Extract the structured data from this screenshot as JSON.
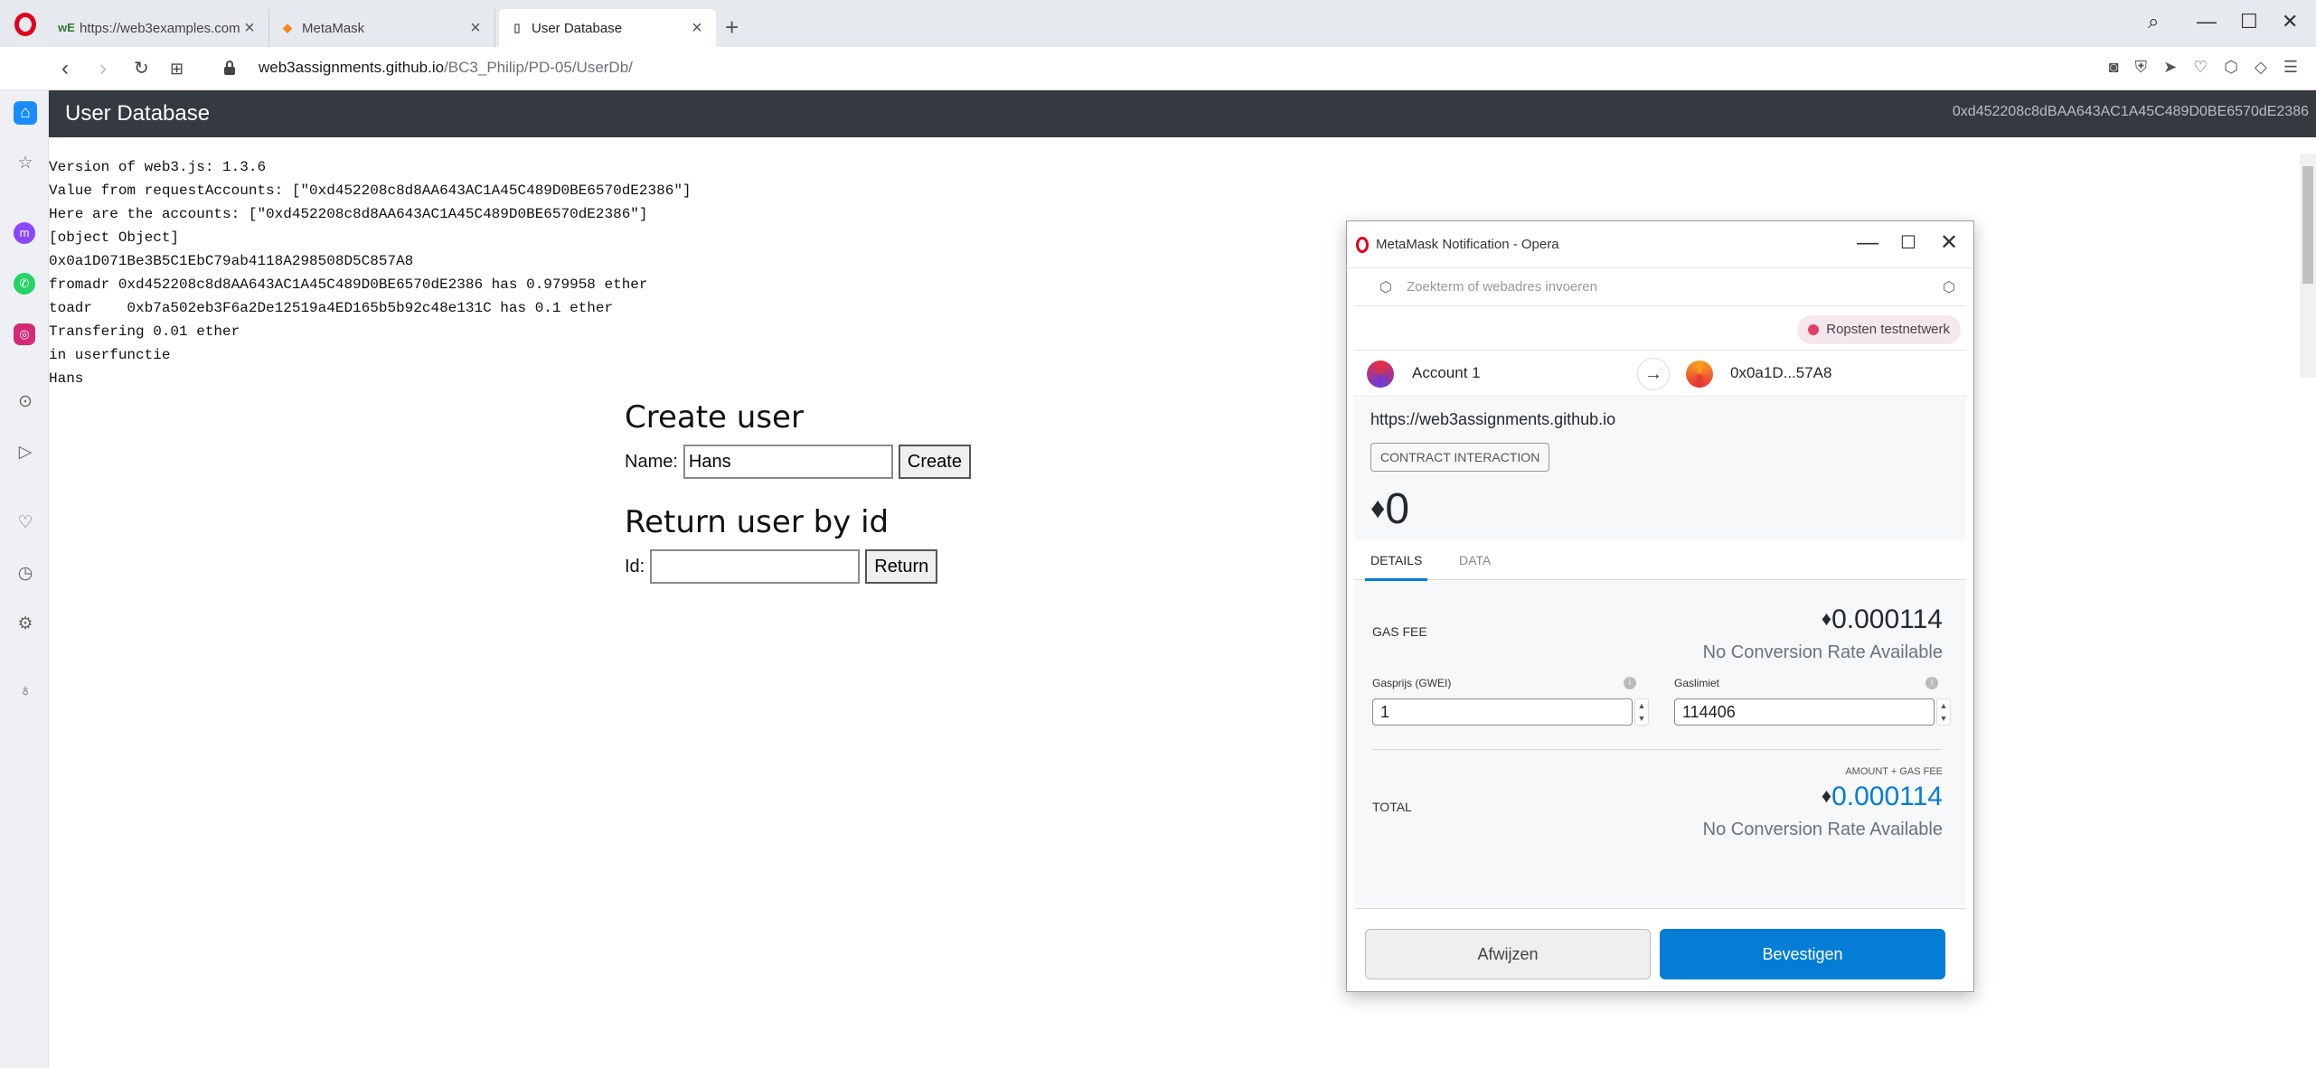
{
  "browser": {
    "tabs": [
      {
        "label": "https://web3examples.com",
        "favicon": "wE"
      },
      {
        "label": "MetaMask",
        "favicon": "fox"
      },
      {
        "label": "User Database",
        "favicon": "doc"
      }
    ],
    "url_host": "web3assignments.github.io",
    "url_path": "/BC3_Philip/PD-05/UserDb/"
  },
  "page": {
    "title": "User Database",
    "address": "0xd452208c8dBAA643AC1A45C489D0BE6570dE2386",
    "log": [
      "Version of web3.js: 1.3.6",
      "Value from requestAccounts: [\"0xd452208c8d8AA643AC1A45C489D0BE6570dE2386\"]",
      "Here are the accounts: [\"0xd452208c8d8AA643AC1A45C489D0BE6570dE2386\"]",
      "[object Object]",
      "0x0a1D071Be3B5C1EbC79ab4118A298508D5C857A8",
      "fromadr 0xd452208c8d8AA643AC1A45C489D0BE6570dE2386 has 0.979958 ether",
      "toadr    0xb7a502eb3F6a2De12519a4ED165b5b92c48e131C has 0.1 ether",
      "Transfering 0.01 ether",
      "in userfunctie",
      "Hans"
    ],
    "create": {
      "heading": "Create user",
      "label": "Name:",
      "value": "Hans",
      "button": "Create"
    },
    "lookup": {
      "heading": "Return user by id",
      "label": "Id:",
      "value": "",
      "button": "Return"
    }
  },
  "metamask": {
    "window_title": "MetaMask Notification - Opera",
    "search_placeholder": "Zoekterm of webadres invoeren",
    "network": "Ropsten testnetwerk",
    "from_account": "Account 1",
    "to_account": "0x0a1D...57A8",
    "origin": "https://web3assignments.github.io",
    "tag": "CONTRACT INTERACTION",
    "amount": "0",
    "tab_details": "DETAILS",
    "tab_data": "DATA",
    "gas_fee_label": "GAS FEE",
    "gas_fee_value": "0.000114",
    "no_conversion": "No Conversion Rate Available",
    "gas_price_label": "Gasprijs (GWEI)",
    "gas_price_value": "1",
    "gas_limit_label": "Gaslimiet",
    "gas_limit_value": "114406",
    "amount_gas_label": "AMOUNT + GAS FEE",
    "total_label": "TOTAL",
    "total_value": "0.000114",
    "reject_label": "Afwijzen",
    "confirm_label": "Bevestigen"
  },
  "colors": {
    "header_bg": "#343a40",
    "accent_blue": "#037dd6",
    "network_dot": "#e23e6c",
    "opera_red": "#e0001b"
  }
}
